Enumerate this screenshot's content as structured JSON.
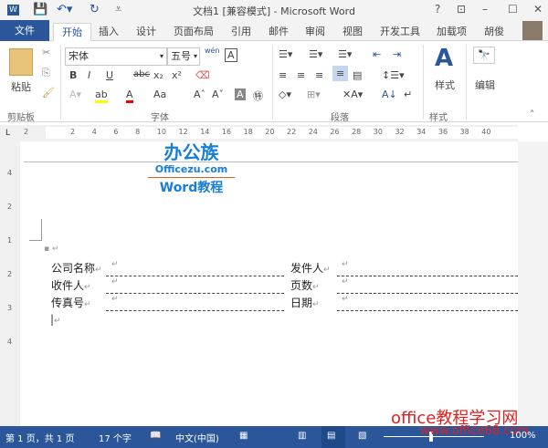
{
  "title": "文档1 [兼容模式] - Microsoft Word",
  "window_controls": [
    "?",
    "restore-ribbon",
    "minimize",
    "maximize",
    "close"
  ],
  "tabs": {
    "file": "文件",
    "items": [
      "开始",
      "插入",
      "设计",
      "页面布局",
      "引用",
      "邮件",
      "审阅",
      "视图",
      "开发工具",
      "加载项"
    ],
    "user": "胡俊"
  },
  "ribbon": {
    "clipboard": {
      "paste": "粘贴",
      "label": "剪贴板"
    },
    "font": {
      "name": "宋体",
      "size": "五号",
      "label": "字体",
      "bold": "B",
      "italic": "I",
      "underline": "U",
      "strike": "abc",
      "sub": "x₂",
      "sup": "x²",
      "case": "Aa",
      "phonetic": "wén",
      "highlight_color": "#ffff00",
      "font_color": "#e00000"
    },
    "paragraph": {
      "label": "段落"
    },
    "styles": {
      "button": "样式",
      "label": "样式"
    },
    "editing": {
      "button": "编辑"
    }
  },
  "ruler": [
    "2",
    "2",
    "4",
    "6",
    "8",
    "10",
    "12",
    "14",
    "16",
    "18",
    "20",
    "22",
    "24",
    "26",
    "28",
    "30",
    "32",
    "34",
    "36",
    "38",
    "40"
  ],
  "vruler": [
    "4",
    "2",
    "1",
    "2",
    "3",
    "4"
  ],
  "logo": {
    "brand": "办公族",
    "site": "Officezu.com",
    "sub": "Word教程"
  },
  "form": {
    "rows": [
      {
        "left": "公司名称",
        "right": "发件人"
      },
      {
        "left": "收件人",
        "right": "页数"
      },
      {
        "left": "传真号",
        "right": "日期"
      }
    ]
  },
  "status": {
    "page": "第 1 页，共 1 页",
    "words": "17 个字",
    "lang": "中文(中国)",
    "zoom": "100%",
    "zoom_level": 100
  },
  "watermark": {
    "title": "office教程学习网",
    "url": "www.office68.com"
  },
  "colors": {
    "accent": "#2b579a"
  }
}
